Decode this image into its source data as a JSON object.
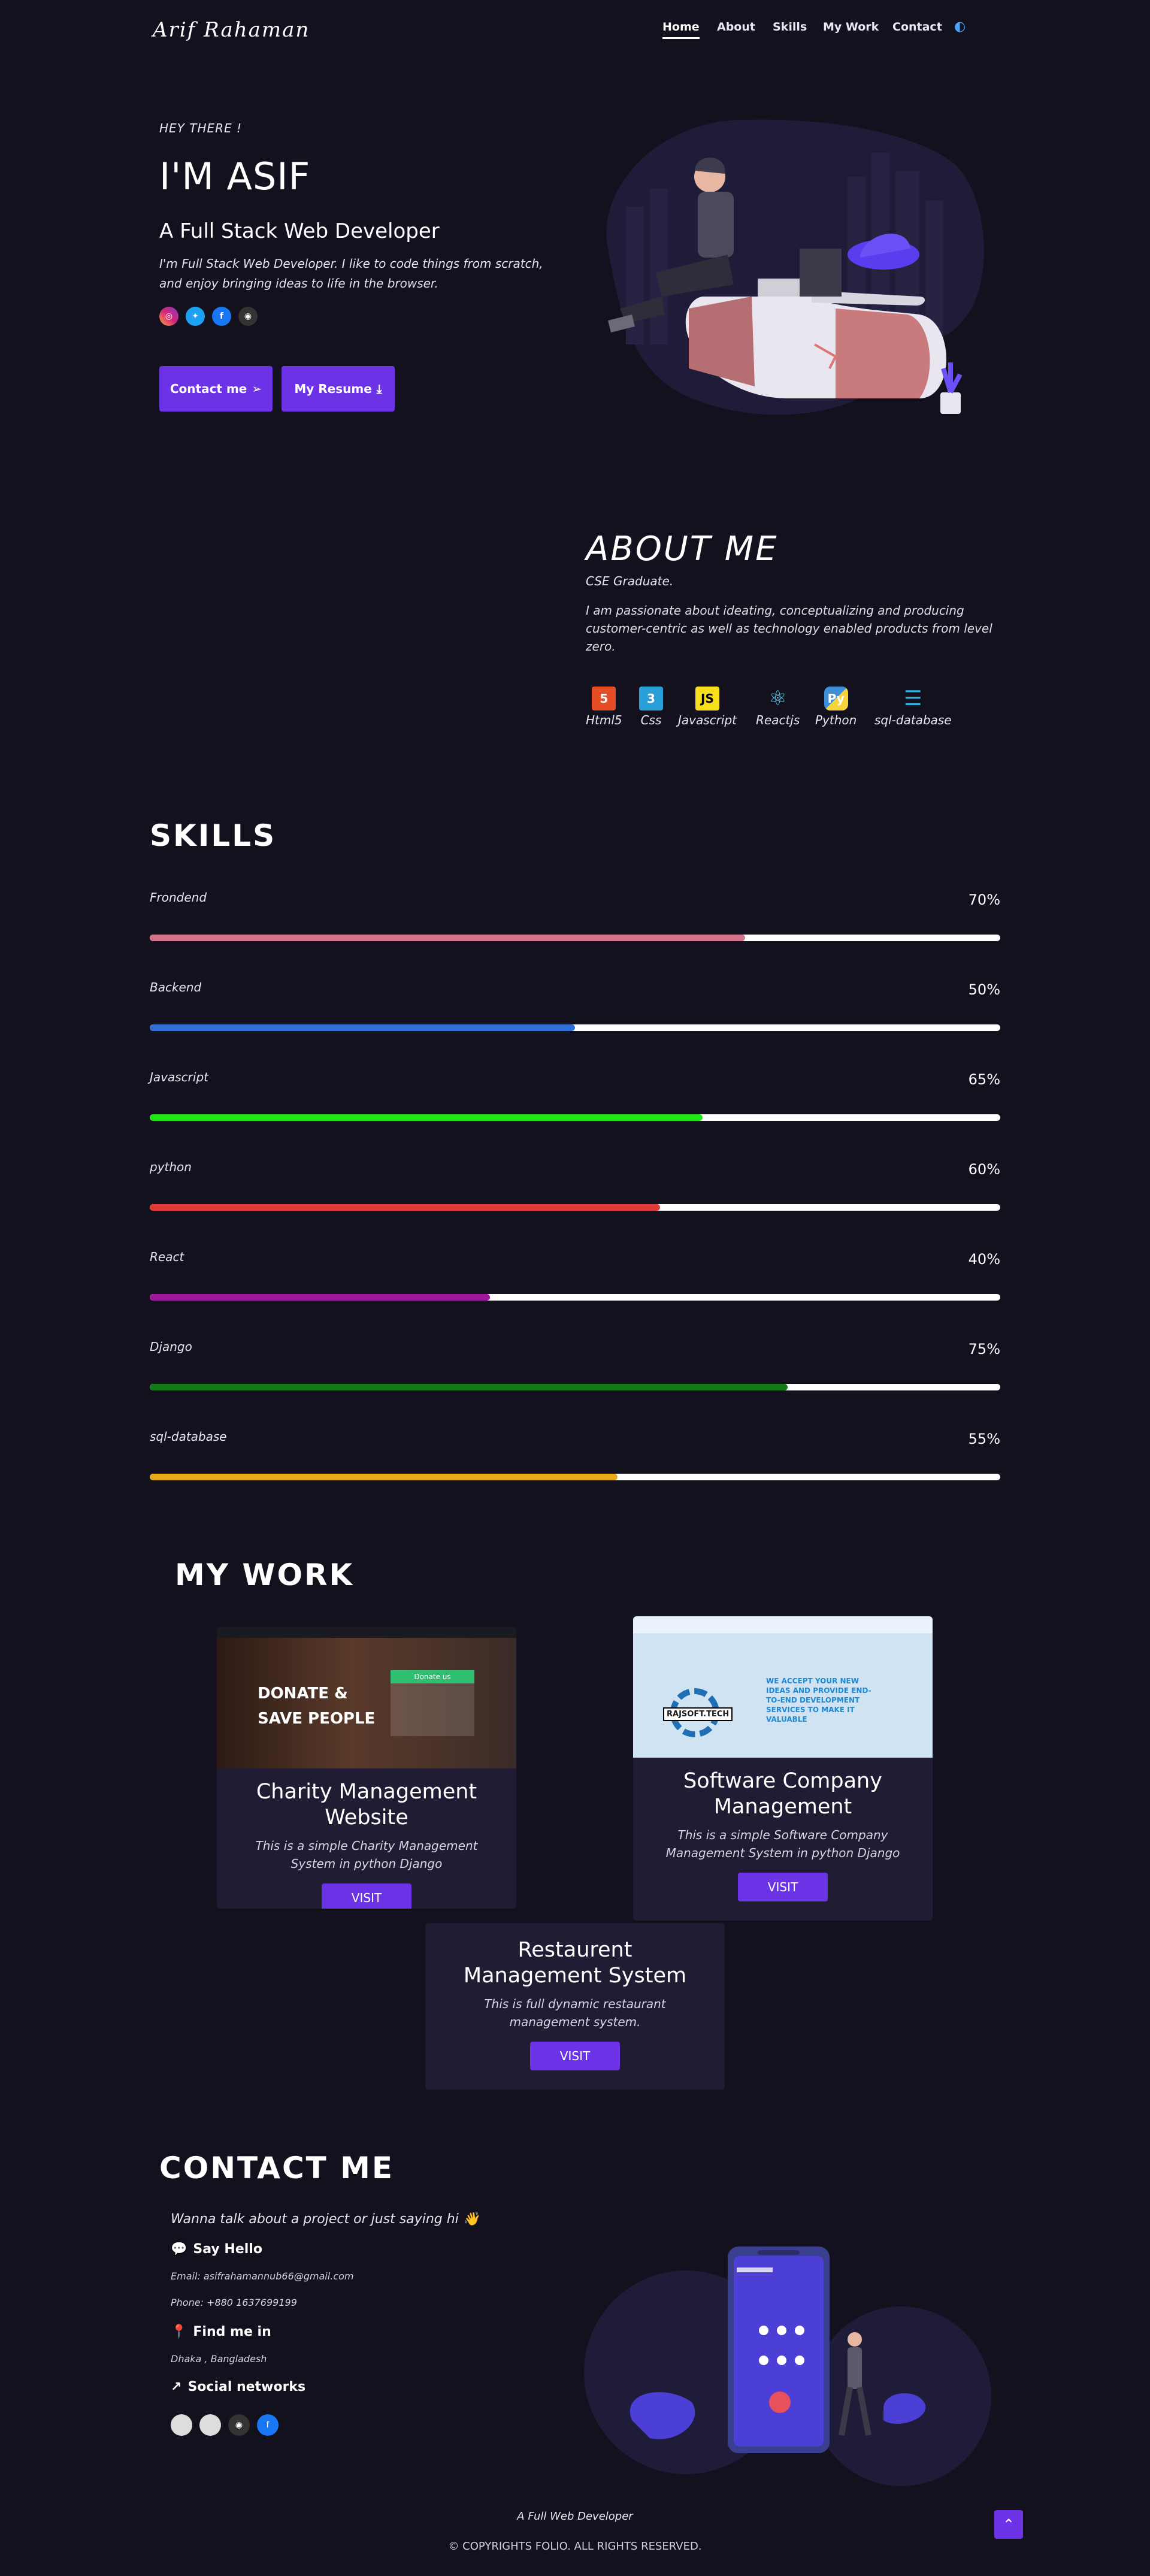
{
  "nav": {
    "logo": "Arif Rahaman",
    "items": [
      "Home",
      "About",
      "Skills",
      "My Work",
      "Contact"
    ],
    "theme_icon": "◐"
  },
  "hero": {
    "greeting": "HEY THERE !",
    "title": "I'M ASIF",
    "subtitle": "A Full Stack Web Developer",
    "description": "I'm Full Stack Web Developer. I like to code things from scratch, and enjoy bringing ideas to life in the browser.",
    "social_icons": [
      "instagram-icon",
      "twitter-icon",
      "facebook-icon",
      "github-icon"
    ],
    "contact_btn": "Contact me",
    "resume_btn": "My Resume"
  },
  "about": {
    "title": "ABOUT ME",
    "subtitle": "CSE Graduate.",
    "description": "I am passionate about ideating, conceptualizing and producing customer-centric as well as technology enabled products from level zero.",
    "tech": [
      {
        "label": "Html5",
        "icon": "html5-icon",
        "color": "#e44d26"
      },
      {
        "label": "Css",
        "icon": "css3-icon",
        "color": "#2a9fd8"
      },
      {
        "label": "Javascript",
        "icon": "javascript-icon",
        "color": "#f7df1e"
      },
      {
        "label": "Reactjs",
        "icon": "react-icon",
        "color": "#61dafb"
      },
      {
        "label": "Python",
        "icon": "python-icon",
        "color": "#3d8fd8"
      },
      {
        "label": "sql-database",
        "icon": "database-icon",
        "color": "#2fb6e0"
      }
    ]
  },
  "skills": {
    "title": "SKILLS",
    "items": [
      {
        "name": "Frondend",
        "pct": "70%",
        "value": 0.7,
        "color": "#d4748c"
      },
      {
        "name": "Backend",
        "pct": "50%",
        "value": 0.5,
        "color": "#2f6fd6"
      },
      {
        "name": "Javascript",
        "pct": "65%",
        "value": 0.65,
        "color": "#22e617"
      },
      {
        "name": "python",
        "pct": "60%",
        "value": 0.6,
        "color": "#e23a3a"
      },
      {
        "name": "React",
        "pct": "40%",
        "value": 0.4,
        "color": "#a2189c"
      },
      {
        "name": "Django",
        "pct": "75%",
        "value": 0.75,
        "color": "#127a17"
      },
      {
        "name": "sql-database",
        "pct": "55%",
        "value": 0.55,
        "color": "#e6ab1a"
      }
    ]
  },
  "work": {
    "title": "MY WORK",
    "projects": [
      {
        "title": "Charity Management Website",
        "desc": "This is a simple Charity Management System in python Django",
        "visit": "VISIT",
        "thumb_text1": "DONATE &",
        "thumb_text2": "SAVE PEOPLE",
        "thumb_btn": "Donate us"
      },
      {
        "title": "Software Company Management",
        "desc": "This is a simple Software Company Management System in python Django",
        "visit": "VISIT",
        "thumb_text1": "WE ACCEPT YOUR NEW IDEAS AND PROVIDE END-TO-END DEVELOPMENT SERVICES TO MAKE IT VALUABLE",
        "thumb_text2": "RAJSOFT.TECH"
      },
      {
        "title": "Restaurent Management System",
        "desc": "This is full dynamic restaurant management system.",
        "visit": "VISIT"
      }
    ]
  },
  "contact": {
    "title": "CONTACT ME",
    "lead": "Wanna talk about a project or just saying hi",
    "wave": "👋",
    "say_hello": "Say Hello",
    "email": "Email: asifrahamannub66@gmail.com",
    "phone": "Phone: +880 1637699199",
    "find_me": "Find me in",
    "location": "Dhaka , Bangladesh",
    "social_networks": "Social networks"
  },
  "footer": {
    "tagline": "A Full Web Developer",
    "copyright": "© COPYRIGHTS FOLIO. ALL RIGHTS RESERVED."
  }
}
